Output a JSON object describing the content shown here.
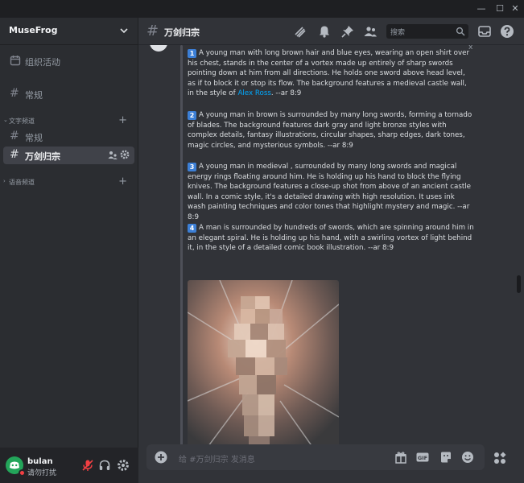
{
  "window": {
    "minimize_glyph": "—",
    "maximize_glyph": "☐",
    "close_glyph": "✕"
  },
  "server": {
    "name": "MuseFrog"
  },
  "sidebar": {
    "events_label": "组织活动",
    "general_top_label": "常规",
    "text_category": "文字频道",
    "text_channels": [
      {
        "label": "常规",
        "active": false
      },
      {
        "label": "万剑归宗",
        "active": true
      }
    ],
    "voice_category": "语音频道"
  },
  "user": {
    "name": "bulan",
    "status": "请勿打扰"
  },
  "channel": {
    "name": "万剑归宗"
  },
  "search": {
    "placeholder": "搜索"
  },
  "top_close_glyph": "x",
  "message": {
    "prompts": [
      {
        "num": "1",
        "text_before": "A young man with long brown hair and blue eyes, wearing an open shirt over his chest, stands in the center of a vortex made up entirely of sharp swords pointing down at him from all directions. He holds one sword above head level, as if to block it or stop its flow. The background features a medieval castle wall, in the style of ",
        "link": "Alex Ross",
        "text_after": ". --ar 8:9"
      },
      {
        "num": "2",
        "text_before": "A young man in brown is surrounded by many long swords, forming a tornado of blades. The background features dark gray and light bronze styles with complex details, fantasy illustrations, circular shapes, sharp edges, dark tones, magic circles, and mysterious symbols. --ar 8:9"
      },
      {
        "num": "3",
        "text_before": "A young man in medieval , surrounded by many long swords and magical energy rings floating around him. He is holding up his hand to block the flying knives. The background features a close-up shot from above of an ancient castle wall. In a comic style, it's a detailed drawing with high resolution. It uses ink wash painting techniques and color tones that highlight mystery and magic. --ar 8:9"
      },
      {
        "num": "4",
        "text_before": "A man is surrounded by hundreds of swords, which are spinning around him in an elegant spiral. He is holding up his hand, with a swirling vortex of light behind it, in the style of a detailed comic book illustration. --ar 8:9"
      }
    ]
  },
  "composer": {
    "placeholder": "给 #万剑归宗 发消息"
  },
  "colors": {
    "accent_link": "#00a8fc",
    "number_badge": "#3c7fd6",
    "online_green": "#23a55a",
    "dnd_red": "#f23f43"
  }
}
